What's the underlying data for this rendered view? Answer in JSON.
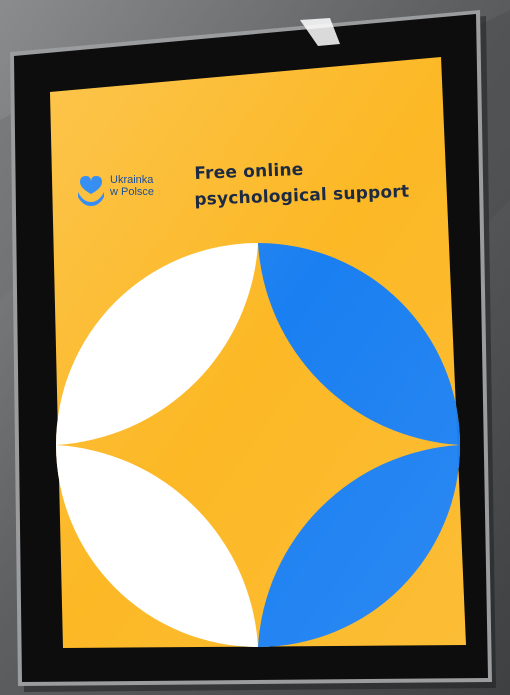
{
  "poster": {
    "brand": {
      "line1": "Ukrainka",
      "line2": "w Polsce",
      "icon": "heart-hands-icon"
    },
    "headline": {
      "line1": "Free online",
      "line2": "psychological support"
    }
  },
  "colors": {
    "poster_yellow": "#fcb825",
    "blue": "#1a7ff1",
    "white": "#ffffff",
    "frame": "#0d0d0e",
    "wall": "#5a5c5d",
    "text_dark": "#1c2a44",
    "brand_blue": "#1b4f9a"
  }
}
